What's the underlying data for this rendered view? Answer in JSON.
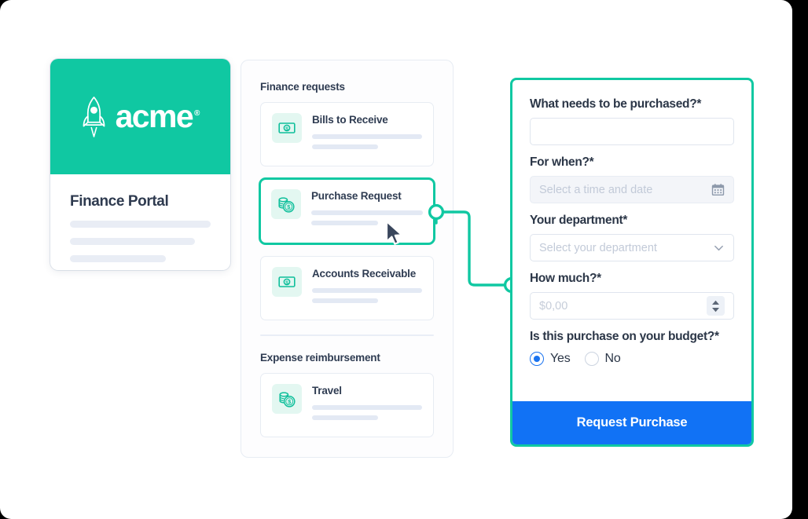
{
  "theme": {
    "brand_green": "#10C8A2",
    "accent_blue": "#1172f5",
    "radio_blue": "#1a73f0",
    "text_dark": "#2b3647",
    "placeholder": "#c2cad8"
  },
  "left_card": {
    "brand_name": "acme",
    "brand_registered": "®",
    "logo_icon": "rocket-icon",
    "title": "Finance Portal"
  },
  "middle_card": {
    "sections": [
      {
        "title": "Finance requests",
        "items": [
          {
            "label": "Bills to Receive",
            "icon": "banknote-icon",
            "selected": false
          },
          {
            "label": "Purchase Request",
            "icon": "coins-icon",
            "selected": true
          },
          {
            "label": "Accounts Receivable",
            "icon": "banknote-icon",
            "selected": false
          }
        ]
      },
      {
        "title": "Expense reimbursement",
        "items": [
          {
            "label": "Travel",
            "icon": "coins-icon",
            "selected": false
          }
        ]
      }
    ]
  },
  "form": {
    "fields": [
      {
        "label": "What needs to be purchased?*",
        "type": "text",
        "value": "",
        "placeholder": ""
      },
      {
        "label": "For when?*",
        "type": "date",
        "value": "",
        "placeholder": "Select a time and date",
        "icon": "calendar-icon"
      },
      {
        "label": "Your department*",
        "type": "select",
        "value": "",
        "placeholder": "Select your department",
        "icon": "chevron-down-icon"
      },
      {
        "label": "How much?*",
        "type": "number",
        "value": "",
        "placeholder": "$0,00",
        "icon": "stepper-icon"
      }
    ],
    "budget_question": {
      "label": "Is this purchase on your budget?*",
      "options": [
        {
          "label": "Yes",
          "selected": true
        },
        {
          "label": "No",
          "selected": false
        }
      ]
    },
    "submit_label": "Request Purchase"
  },
  "connector": {
    "node_start": "connector-node-source",
    "node_end": "connector-node-target"
  },
  "cursor": {
    "name": "mouse-pointer"
  }
}
